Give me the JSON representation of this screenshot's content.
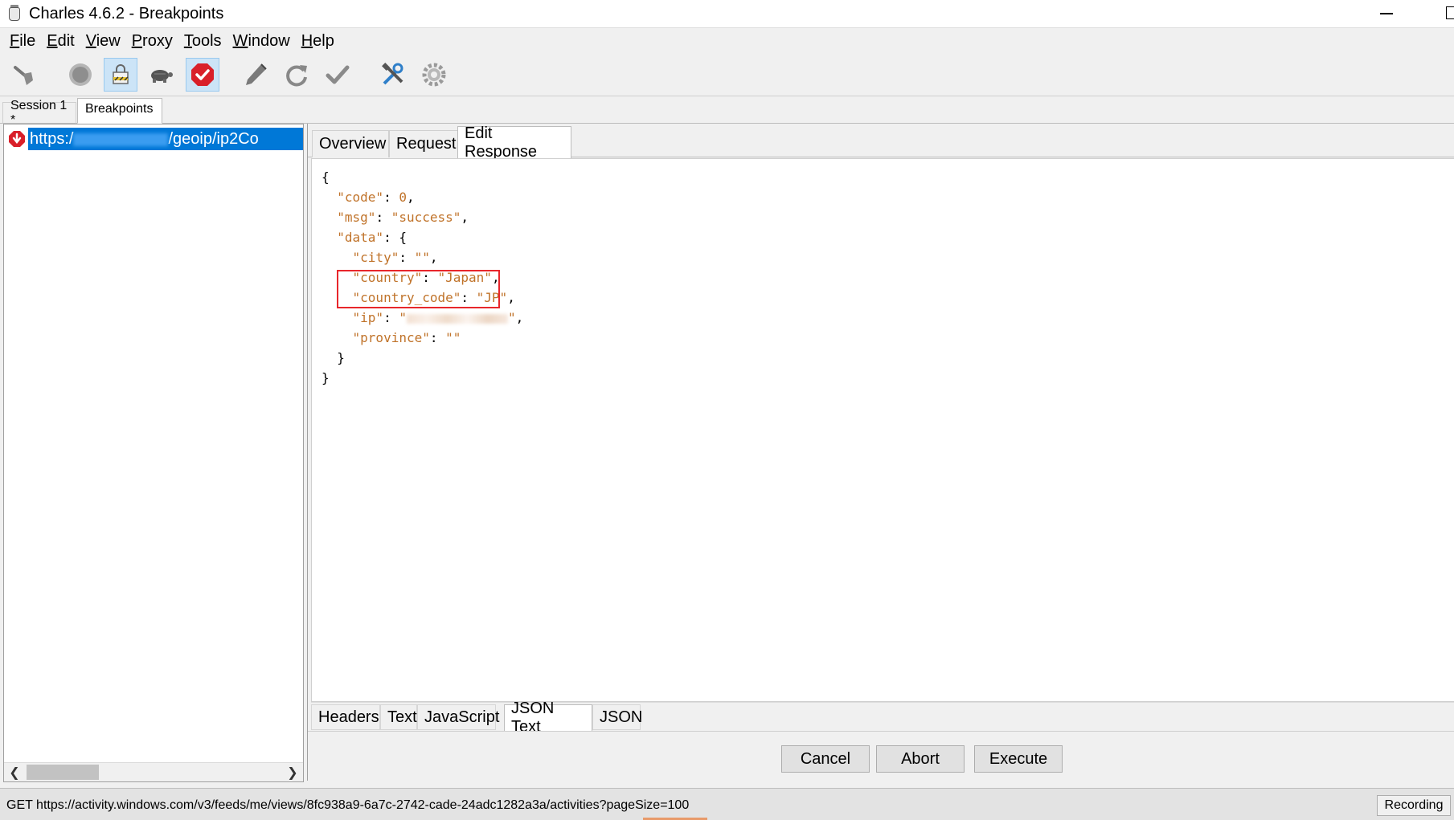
{
  "window": {
    "title": "Charles 4.6.2 - Breakpoints"
  },
  "menu": [
    {
      "label": "File"
    },
    {
      "label": "Edit"
    },
    {
      "label": "View"
    },
    {
      "label": "Proxy"
    },
    {
      "label": "Tools"
    },
    {
      "label": "Window"
    },
    {
      "label": "Help"
    }
  ],
  "toolbar": {
    "icons": [
      "broom-icon",
      "record-icon",
      "ssl-proxying-icon",
      "throttle-icon",
      "breakpoints-icon",
      "compose-icon",
      "repeat-icon",
      "validate-icon",
      "tools-icon",
      "settings-icon"
    ]
  },
  "session_tabs": {
    "session": "Session 1 *",
    "breakpoints": "Breakpoints"
  },
  "request": {
    "url_prefix": "https:/",
    "url_suffix": "/geoip/ip2Co"
  },
  "response_tabs": {
    "overview": "Overview",
    "request": "Request",
    "edit_response": "Edit Response"
  },
  "json": {
    "code_key": "\"code\"",
    "code_val": "0",
    "msg_key": "\"msg\"",
    "msg_val": "\"success\"",
    "data_key": "\"data\"",
    "city_key": "\"city\"",
    "city_val": "\"\"",
    "country_key": "\"country\"",
    "country_val": "\"Japan\"",
    "country_code_key": "\"country_code\"",
    "country_code_val": "\"JP\"",
    "ip_key": "\"ip\"",
    "province_key": "\"province\"",
    "province_val": "\"\""
  },
  "bottom_tabs": {
    "headers": "Headers",
    "text": "Text",
    "javascript": "JavaScript",
    "json_text": "JSON Text",
    "json": "JSON"
  },
  "actions": {
    "cancel": "Cancel",
    "abort": "Abort",
    "execute": "Execute"
  },
  "status": {
    "text": "GET https://activity.windows.com/v3/feeds/me/views/8fc938a9-6a7c-2742-cade-24adc1282a3a/activities?pageSize=100",
    "recording": "Recording"
  },
  "colors": {
    "selection": "#0078d7",
    "json_string": "#c0732a",
    "highlight": "#e8262b",
    "active_toolbar": "#cce4f7"
  }
}
